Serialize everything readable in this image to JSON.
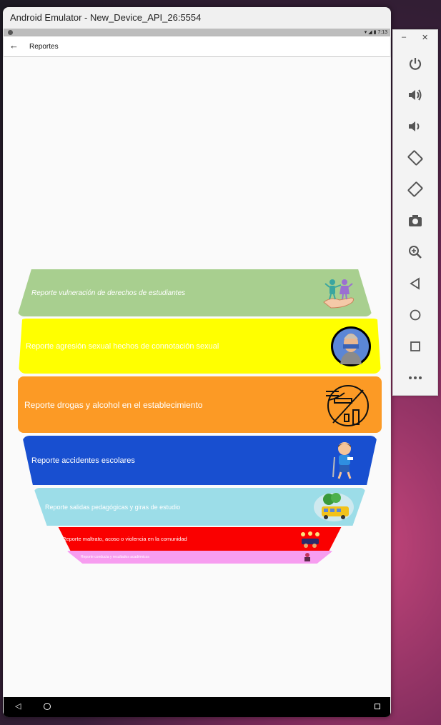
{
  "window": {
    "title": "Android Emulator - New_Device_API_26:5554"
  },
  "status_bar": {
    "time": "7:13"
  },
  "app_bar": {
    "title": "Reportes"
  },
  "reports": [
    {
      "label": "Reporte vulneración de derechos de estudiantes",
      "color": "#a8cf8f",
      "icon": "children-on-hand-icon"
    },
    {
      "label": "Reporte agresión sexual hechos de connotación sexual",
      "color": "#ffff00",
      "icon": "silenced-person-icon"
    },
    {
      "label": "Reporte drogas y alcohol en el establecimiento",
      "color": "#fc9a25",
      "icon": "drugs-alcohol-icon"
    },
    {
      "label": "Reporte accidentes escolares",
      "color": "#184fd0",
      "icon": "injured-child-icon"
    },
    {
      "label": "Reporte salidas pedagógicas y giras de estudio",
      "color": "#9cdde8",
      "icon": "school-bus-icon"
    },
    {
      "label": "Reporte maltrato, acoso o violencia en la comunidad",
      "color": "#fa0000",
      "icon": "bullying-icon"
    },
    {
      "label": "Reporte conducta y resultados académicos",
      "color": "#f79df0",
      "icon": "student-icon"
    }
  ],
  "emulator_controls": [
    "power-icon",
    "volume-up-icon",
    "volume-down-icon",
    "rotate-left-icon",
    "rotate-right-icon",
    "camera-icon",
    "zoom-icon",
    "back-icon",
    "home-icon",
    "overview-icon",
    "more-icon"
  ]
}
